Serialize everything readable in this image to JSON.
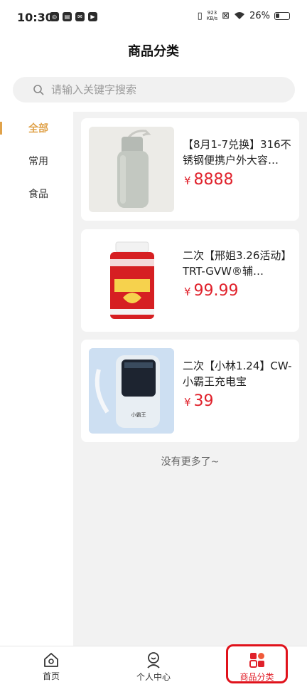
{
  "status_bar": {
    "time": "10:30",
    "net_speed_value": "923",
    "net_speed_unit": "KB/s",
    "battery": "26%"
  },
  "header": {
    "title": "商品分类"
  },
  "search": {
    "placeholder": "请输入关键字搜索"
  },
  "categories": [
    {
      "label": "全部",
      "active": true
    },
    {
      "label": "常用",
      "active": false
    },
    {
      "label": "食品",
      "active": false
    }
  ],
  "products": [
    {
      "name": "【8月1-7兑换】316不锈钢便携户外大容…",
      "currency": "¥",
      "price": "8888",
      "thumb_icon": "thermos-bottle-image"
    },
    {
      "name": "二次【邢姐3.26活动】TRT-GVW®辅…",
      "currency": "¥",
      "price": "99.99",
      "thumb_icon": "supplement-bottle-image"
    },
    {
      "name": "二次【小林1.24】CW-小霸王充电宝",
      "currency": "¥",
      "price": "39",
      "thumb_icon": "power-bank-image"
    }
  ],
  "list_footer": "没有更多了~",
  "tabbar": {
    "items": [
      {
        "label": "首页",
        "icon": "home-icon"
      },
      {
        "label": "个人中心",
        "icon": "user-icon"
      },
      {
        "label": "商品分类",
        "icon": "category-grid-icon",
        "active": true
      }
    ]
  },
  "colors": {
    "accent": "#e0a24a",
    "price": "#e0212b",
    "highlight": "#e0121b"
  }
}
